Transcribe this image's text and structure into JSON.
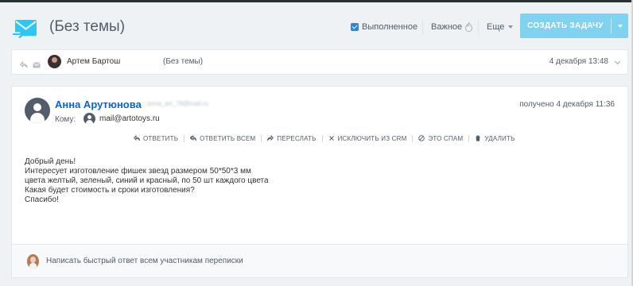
{
  "header": {
    "title": "(Без темы)",
    "done_label": "Выполненное",
    "important_label": "Важное",
    "more_label": "Еще",
    "create_task_label": "СОЗДАТЬ ЗАДАЧУ"
  },
  "thread": {
    "sender": "Артем Бартош",
    "subject": "(Без темы)",
    "date": "4 декабря 13:48"
  },
  "message": {
    "sender_name": "Анна Арутюнова",
    "sender_email": "anna_art_78@mail.ru",
    "received": "получено 4 декабря 11:36",
    "to_label": "Кому:",
    "to_address": "mail@artotoys.ru",
    "actions": {
      "reply": "ОТВЕТИТЬ",
      "reply_all": "ОТВЕТИТЬ ВСЕМ",
      "forward": "ПЕРЕСЛАТЬ",
      "exclude_crm": "ИСКЛЮЧИТЬ ИЗ CRM",
      "spam": "ЭТО СПАМ",
      "delete": "УДАЛИТЬ"
    },
    "body_lines": [
      "Добрый день!",
      "Интересует изготовление фишек звезд размером 50*50*3 мм",
      "цвета желтый, зеленый, синий и красный, по 50 шт каждого цвета",
      "Какая будет стоимость и сроки изготовления?",
      "Спасибо!"
    ]
  },
  "quick_reply": {
    "placeholder": "Написать быстрый ответ всем участникам переписки"
  },
  "colors": {
    "accent": "#2fc6f6",
    "button": "#7fd3f0",
    "link": "#0b66c3",
    "background": "#eef2f4"
  }
}
